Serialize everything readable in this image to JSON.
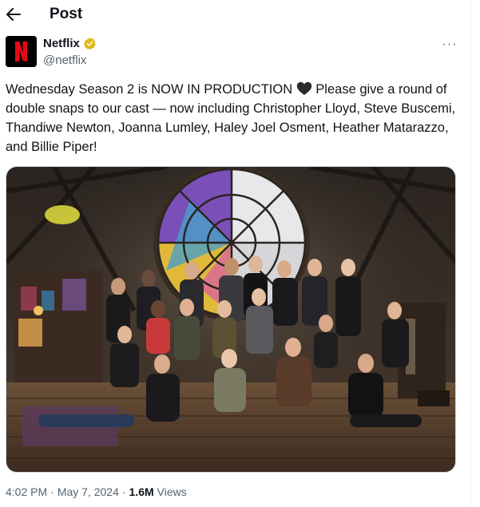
{
  "header": {
    "title": "Post",
    "back_icon": "arrow-left-icon"
  },
  "author": {
    "name": "Netflix",
    "handle": "@netflix",
    "avatar_letter": "N",
    "avatar_color": "#e50914",
    "verified_color": "#e2b719"
  },
  "tweet": {
    "text_before_heart": "Wednesday Season 2 is NOW IN PRODUCTION ",
    "text_after_heart": " Please give a round of double snaps to our cast — now including Christopher Lloyd, Steve Buscemi, Thandiwe Newton, Joanna Lumley, Haley Joel Osment, Heather Matarazzo, and Billie Piper!",
    "heart_icon": "black-heart-icon",
    "heart_color": "#2b2b2b"
  },
  "media": {
    "icon": "photo-icon"
  },
  "meta": {
    "time": "4:02 PM",
    "separator": "·",
    "date": "May 7, 2024",
    "views_count": "1.6M",
    "views_label": "Views"
  },
  "more_icon": "more-horizontal-icon",
  "more_glyph": "···"
}
